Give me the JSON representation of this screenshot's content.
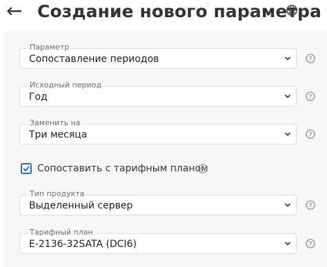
{
  "header": {
    "back_icon": "arrow-left-icon",
    "back_glyph": "←",
    "title": "Создание нового параметра",
    "language_icon": "globe-icon"
  },
  "fields": [
    {
      "label": "Параметр",
      "value": "Сопоставление периодов"
    },
    {
      "label": "Исходный период",
      "value": "Год"
    },
    {
      "label": "Заменить на",
      "value": "Три месяца"
    },
    {
      "label": "Тип продукта",
      "value": "Выделенный сервер"
    },
    {
      "label": "Тарифный план",
      "value": "E-2136-32SATA (DCI6)"
    }
  ],
  "compare_tariff": {
    "checked": true,
    "label": "Сопоставить с тарифным планом"
  },
  "icons": {
    "dropdown": "chevron-down-icon",
    "help": "question-circle-icon"
  },
  "colors": {
    "accent": "#1a73c8",
    "panel_background": "#f7f7f7",
    "border": "#dcdcdc"
  }
}
